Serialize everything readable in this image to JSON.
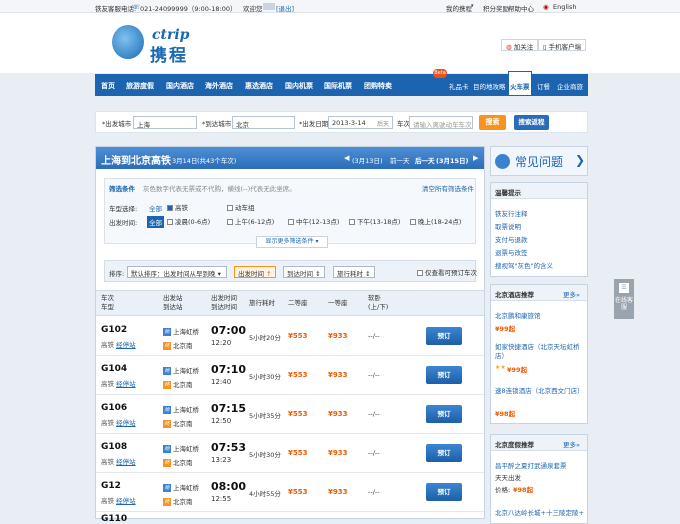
{
  "topbar": {
    "hotline": "铁友客服电话:",
    "phone": "021-24099999（9:00-18:00）",
    "welcome": "欢迎您",
    "logout": "[退出]",
    "my_account": "我的携程",
    "points": "积分奖励",
    "help": "帮助中心",
    "language": "English"
  },
  "header": {
    "logo_en": "ctrip",
    "logo_cn": "携程",
    "follow": "加关注",
    "mobile": "手机客户端"
  },
  "nav": {
    "items": [
      "首页",
      "旅游度假",
      "国内酒店",
      "海外酒店",
      "惠选酒店",
      "国内机票",
      "国际机票",
      "团购特卖"
    ],
    "sub_items": [
      "礼品卡",
      "目的地攻略",
      "火车票",
      "订餐",
      "企业商旅"
    ],
    "beta": "Beta"
  },
  "search": {
    "from_label": "*出发城市",
    "from_value": "上海",
    "to_label": "*到达城市",
    "to_value": "北京",
    "date_label": "*出发日期",
    "date_value": "2013-3-14",
    "date_hint": "后天",
    "train_label": "车次",
    "train_placeholder": "请输入离驶动车车次",
    "search_button": "搜索",
    "return_button": "搜索返程"
  },
  "result": {
    "title": "上海到北京高铁",
    "date": "3月14日",
    "count": "(共43个车次)",
    "prev_date": "(3月13日)",
    "prev": "前一天",
    "next": "后一天",
    "next_date": "(3月15日)"
  },
  "filter": {
    "heading": "筛选条件",
    "hint": "灰色数字代表无票或不代购，横线(--)代表无此坐席。",
    "clear": "清空所有筛选条件",
    "type_label": "车型选择:",
    "type_all": "全部",
    "type_gaotie": "高铁",
    "type_dongche": "动车组",
    "time_label": "出发时间:",
    "time_all": "全部",
    "time_options": [
      "凌晨(0-6点)",
      "上午(6-12点)",
      "中午(12-13点)",
      "下午(13-18点)",
      "晚上(18-24点)"
    ],
    "more": "显示更多筛选条件"
  },
  "sort": {
    "label": "排序:",
    "default": "默认排序：出发时间从早到晚",
    "dep": "出发时间",
    "arr": "到达时间",
    "dur": "旅行耗时",
    "bookable": "仅查看可预订车次"
  },
  "table": {
    "headers": {
      "train": [
        "车次",
        "车型"
      ],
      "station": [
        "出发站",
        "到达站"
      ],
      "time": [
        "出发时间",
        "到达时间"
      ],
      "duration": "旅行耗时",
      "second": "二等座",
      "first": "一等座",
      "sleeper": [
        "软卧",
        "(上/下)"
      ]
    },
    "rows": [
      {
        "no": "G102",
        "type": "高铁",
        "stops": "经停站",
        "from": "上海虹桥",
        "to": "北京南",
        "dep": "07:00",
        "arr": "12:20",
        "dur": "5小时20分",
        "p2": "¥553",
        "p1": "¥933",
        "slp": "--/--",
        "book": "预订"
      },
      {
        "no": "G104",
        "type": "高铁",
        "stops": "经停站",
        "from": "上海虹桥",
        "to": "北京南",
        "dep": "07:10",
        "arr": "12:40",
        "dur": "5小时30分",
        "p2": "¥553",
        "p1": "¥933",
        "slp": "--/--",
        "book": "预订"
      },
      {
        "no": "G106",
        "type": "高铁",
        "stops": "经停站",
        "from": "上海虹桥",
        "to": "北京南",
        "dep": "07:15",
        "arr": "12:50",
        "dur": "5小时35分",
        "p2": "¥553",
        "p1": "¥933",
        "slp": "--/--",
        "book": "预订"
      },
      {
        "no": "G108",
        "type": "高铁",
        "stops": "经停站",
        "from": "上海虹桥",
        "to": "北京南",
        "dep": "07:53",
        "arr": "13:23",
        "dur": "5小时30分",
        "p2": "¥553",
        "p1": "¥933",
        "slp": "--/--",
        "book": "预订"
      },
      {
        "no": "G12",
        "type": "高铁",
        "stops": "经停站",
        "from": "上海虹桥",
        "to": "北京南",
        "dep": "08:00",
        "arr": "12:55",
        "dur": "4小时55分",
        "p2": "¥553",
        "p1": "¥933",
        "slp": "--/--",
        "book": "预订"
      },
      {
        "no": "G110",
        "type": "",
        "stops": "",
        "from": "",
        "to": "",
        "dep": "",
        "arr": "",
        "dur": "",
        "p2": "",
        "p1": "",
        "slp": "",
        "book": ""
      }
    ],
    "badge_from": "始",
    "badge_to": "终"
  },
  "side": {
    "faq_title": "常见问题",
    "tips_title": "温馨提示",
    "tips": [
      "铁友行注释",
      "取票说明",
      "支付与退款",
      "退票与改签",
      "搜视驾\"灰色\"的含义"
    ],
    "hotel_title": "北京酒店推荐",
    "more": "更多»",
    "hotels": [
      {
        "name": "北京鹏和康旅馆",
        "price": "¥99起"
      },
      {
        "name": "如家快捷酒店（北京天坛虹桥店）",
        "price": "¥99起"
      },
      {
        "name": "速8连锁酒店（北京西文门店）",
        "price": "¥98起"
      }
    ],
    "tour_title": "北京度假推荐",
    "tours": [
      {
        "name": "昌平醉之夏打武通泉套票",
        "sub": "天天出发",
        "price_label": "价格:",
        "price": "¥98起"
      },
      {
        "name": "北京八达岭长城+十三陵定陵+",
        "sub": "",
        "price_label": "",
        "price": ""
      }
    ]
  },
  "float": {
    "label": "在线客服"
  },
  "colors": {
    "brand": "#1c64b0",
    "price": "#f05a00",
    "accent": "#e8541f"
  }
}
